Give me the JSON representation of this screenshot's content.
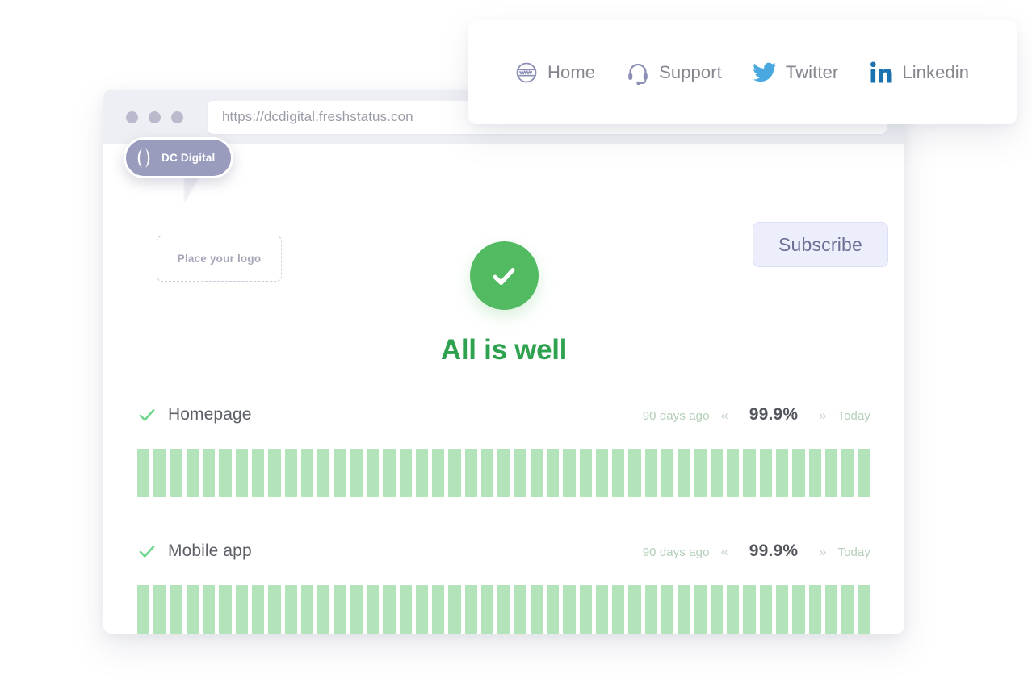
{
  "browser": {
    "url": "https://dcdigital.freshstatus.con",
    "window_dots": [
      "close",
      "minimize",
      "maximize"
    ]
  },
  "cursor": {
    "name": "DC Digital",
    "avatar_icon": "dc-logo-icon"
  },
  "status_page": {
    "logo_placeholder": "Place your logo",
    "subscribe_label": "Subscribe",
    "status_icon": "check-circle-icon",
    "headline": "All is well",
    "accent_green": "#52ba60",
    "headline_green": "#2fa24f",
    "uptime_bar_color": "#b2e3b9",
    "services": [
      {
        "name": "Homepage",
        "status_icon": "check-icon",
        "range_start": "90 days ago",
        "range_end": "Today",
        "uptime": "99.9%",
        "prev_icon": "chevron-double-left-icon",
        "next_icon": "chevron-double-right-icon",
        "bar_count": 45
      },
      {
        "name": "Mobile app",
        "status_icon": "check-icon",
        "range_start": "90 days ago",
        "range_end": "Today",
        "uptime": "99.9%",
        "prev_icon": "chevron-double-left-icon",
        "next_icon": "chevron-double-right-icon",
        "bar_count": 45
      }
    ]
  },
  "social_nav": {
    "items": [
      {
        "label": "Home",
        "icon": "globe-www-icon",
        "icon_color": "#8c8fb5"
      },
      {
        "label": "Support",
        "icon": "headset-icon",
        "icon_color": "#8c8fb5"
      },
      {
        "label": "Twitter",
        "icon": "twitter-icon",
        "icon_color": "#4aa8e0"
      },
      {
        "label": "Linkedin",
        "icon": "linkedin-icon",
        "icon_color": "#1c72b0"
      }
    ]
  }
}
